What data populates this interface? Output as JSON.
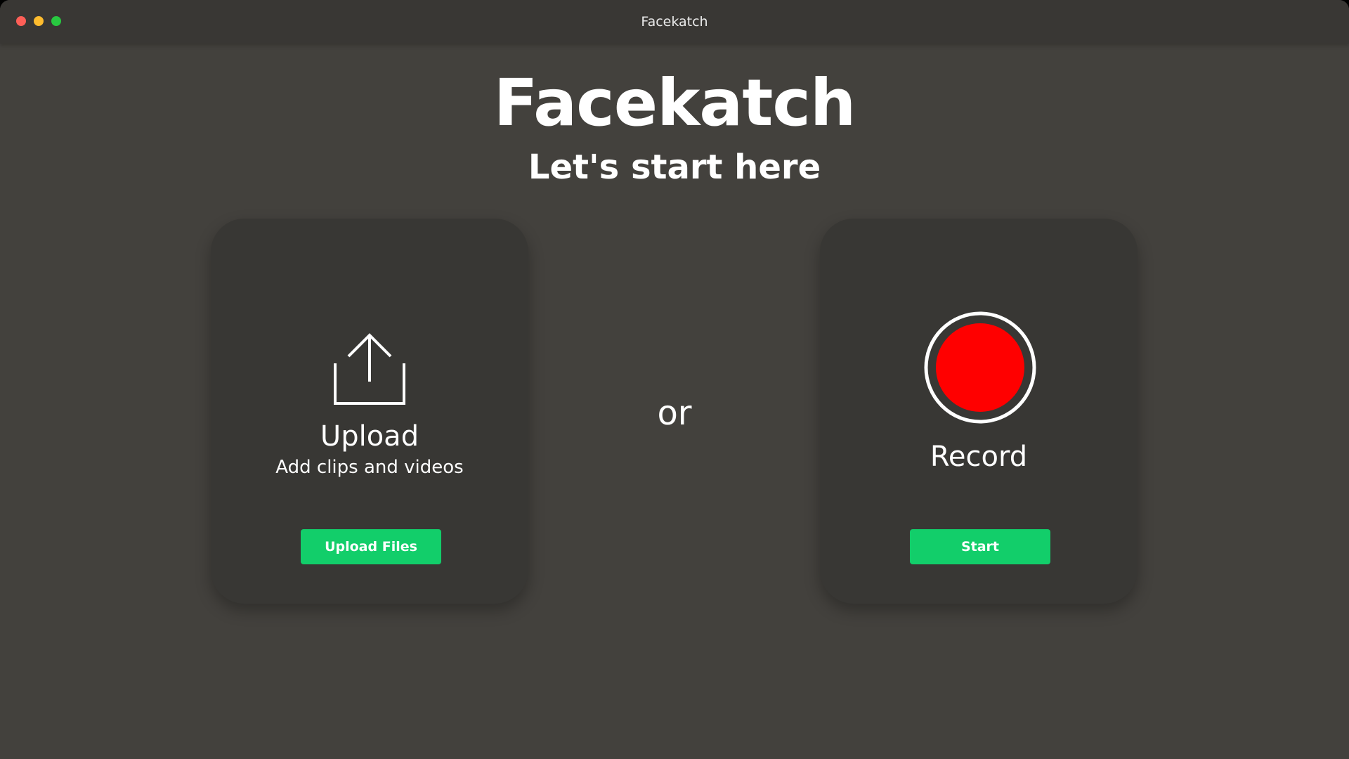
{
  "window": {
    "title": "Facekatch"
  },
  "header": {
    "title": "Facekatch",
    "subtitle": "Let's start here"
  },
  "upload_card": {
    "icon": "upload-icon",
    "heading": "Upload",
    "description": "Add clips and videos",
    "button_label": "Upload Files"
  },
  "separator": {
    "label": "or"
  },
  "record_card": {
    "icon": "record-icon",
    "heading": "Record",
    "button_label": "Start"
  },
  "colors": {
    "background": "#43413d",
    "card": "#383734",
    "accent_green": "#12ce6a",
    "record_red": "#ff0000",
    "close": "#fe5f57",
    "minimize": "#febc2e",
    "maximize": "#28c840"
  }
}
